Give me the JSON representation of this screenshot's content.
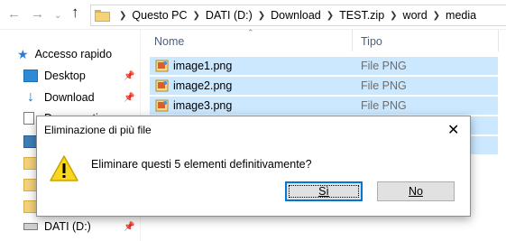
{
  "address_bar": {
    "back_icon": "arrow-left-icon",
    "forward_icon": "arrow-right-icon",
    "recent_icon": "chevron-down-icon",
    "up_icon": "arrow-up-icon",
    "breadcrumbs": [
      "Questo PC",
      "DATI (D:)",
      "Download",
      "TEST.zip",
      "word",
      "media"
    ]
  },
  "nav_pane": {
    "quick_access_label": "Accesso rapido",
    "items": [
      {
        "label": "Desktop",
        "icon": "desktop-icon",
        "pinned": true
      },
      {
        "label": "Download",
        "icon": "download-icon",
        "pinned": true
      },
      {
        "label": "Documenti",
        "icon": "documents-icon",
        "pinned": true
      },
      {
        "label": "",
        "icon": "pictures-icon",
        "pinned": false
      },
      {
        "label": "",
        "icon": "folder-icon",
        "pinned": false
      },
      {
        "label": "",
        "icon": "folder-icon",
        "pinned": false
      },
      {
        "label": "",
        "icon": "folder-icon",
        "pinned": false
      },
      {
        "label": "DATI (D:)",
        "icon": "drive-icon",
        "pinned": true
      }
    ]
  },
  "file_list": {
    "columns": {
      "name": "Nome",
      "type": "Tipo"
    },
    "rows": [
      {
        "name": "image1.png",
        "type": "File PNG"
      },
      {
        "name": "image2.png",
        "type": "File PNG"
      },
      {
        "name": "image3.png",
        "type": "File PNG"
      }
    ]
  },
  "dialog": {
    "title": "Eliminazione di più file",
    "message": "Eliminare questi 5 elementi definitivamente?",
    "yes_label": "Sì",
    "no_label": "No",
    "icon": "warning-icon"
  },
  "colors": {
    "selection": "#cce8ff",
    "dialog_bg": "#f0f0f0",
    "accent": "#0078d7"
  }
}
